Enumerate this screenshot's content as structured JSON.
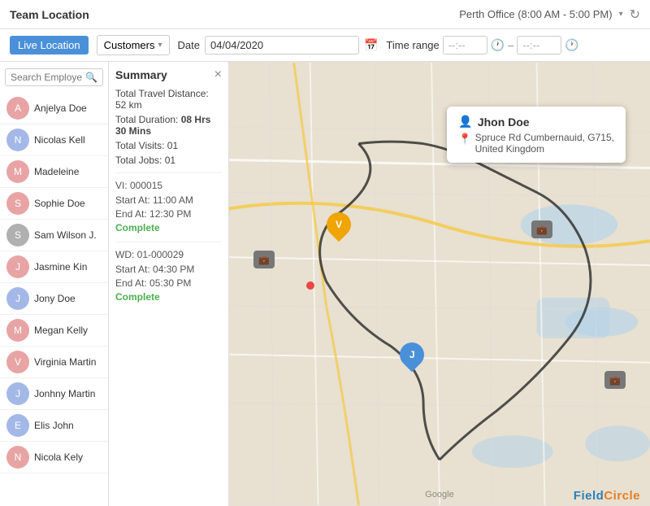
{
  "app": {
    "title": "Team Location",
    "office": "Perth Office (8:00 AM - 5:00 PM)"
  },
  "toolbar": {
    "live_location_label": "Live Location",
    "customers_label": "Customers",
    "date_label": "Date",
    "date_value": "04/04/2020",
    "time_range_label": "Time range",
    "time_start": "--:--",
    "time_end": "--:--",
    "search_placeholder": "Search Employee..."
  },
  "summary": {
    "title": "Summary",
    "total_travel": "Total Travel Distance: 52 km",
    "total_duration": "Total Duration: 08 Hrs 30 Mins",
    "total_visits": "Total Visits: 01",
    "total_jobs": "Total Jobs: 01",
    "visit_id": "VI: 000015",
    "visit_start": "Start At: 11:00 AM",
    "visit_end": "End At: 12:30 PM",
    "visit_status": "Complete",
    "wo_id": "WD: 01-000029",
    "wo_start": "Start At: 04:30 PM",
    "wo_end": "End At: 05:30 PM",
    "wo_status": "Complete"
  },
  "employees": [
    {
      "name": "Anjelya Doe",
      "gender": "female"
    },
    {
      "name": "Nicolas Kell",
      "gender": "male"
    },
    {
      "name": "Madeleine",
      "gender": "female"
    },
    {
      "name": "Sophie Doe",
      "gender": "female"
    },
    {
      "name": "Sam Wilson J.",
      "gender": "neutral"
    },
    {
      "name": "Jasmine Kin",
      "gender": "female"
    },
    {
      "name": "Jony Doe",
      "gender": "male"
    },
    {
      "name": "Megan Kelly",
      "gender": "female"
    },
    {
      "name": "Virginia Martin",
      "gender": "female"
    },
    {
      "name": "Jonhny Martin",
      "gender": "male"
    },
    {
      "name": "Elis John",
      "gender": "male"
    },
    {
      "name": "Nicola Kely",
      "gender": "female"
    }
  ],
  "map_popup": {
    "name": "Jhon Doe",
    "address": "Spruce Rd Cumbernauid, G715,\nUnited Kingdom"
  },
  "footer": {
    "brand": "FieldCircle"
  }
}
